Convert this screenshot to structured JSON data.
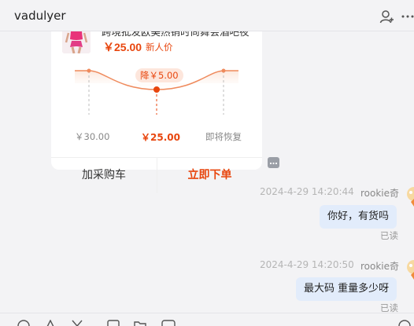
{
  "header": {
    "title": "vadulyer"
  },
  "card": {
    "product_title": "跨境批发欧美热销时尚舞会酒吧夜",
    "price": "￥25.00",
    "price_tag": "新人价",
    "drop_badge": "降￥5.00",
    "original_price": "￥30.00",
    "current_price": "￥25.00",
    "restore_label": "即将恢复",
    "cart_button": "加采购车",
    "buy_button": "立即下单"
  },
  "messages": [
    {
      "time": "2024-4-29 14:20:44",
      "sender": "rookie奇",
      "text": "你好，有货吗",
      "status": "已读"
    },
    {
      "time": "2024-4-29 14:20:50",
      "sender": "rookie奇",
      "text": "最大码 重量多少呀",
      "status": "已读"
    }
  ],
  "colors": {
    "accent": "#e8460e",
    "bubble": "#e2ecfb",
    "background": "#f3f3f5"
  },
  "icons": [
    "add-contact-icon",
    "more-icon",
    "card-menu-icon",
    "emoji-icon",
    "scissors-icon",
    "image-icon",
    "folder-icon",
    "video-icon",
    "chat-icon"
  ]
}
